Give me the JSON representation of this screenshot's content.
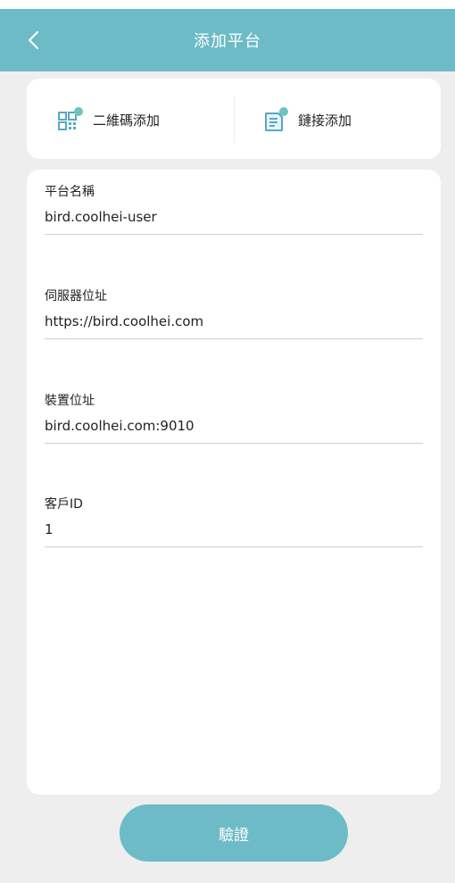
{
  "header": {
    "title": "添加平台",
    "back_icon": "chevron-left-icon",
    "color": "#6dbbc7"
  },
  "add_options": [
    {
      "label": "二維碼添加",
      "icon": "qr-code-icon"
    },
    {
      "label": "鏈接添加",
      "icon": "link-document-icon"
    }
  ],
  "form": {
    "fields": [
      {
        "label": "平台名稱",
        "value": "bird.coolhei-user"
      },
      {
        "label": "伺服器位址",
        "value": "https://bird.coolhei.com"
      },
      {
        "label": "裝置位址",
        "value": "bird.coolhei.com:9010"
      },
      {
        "label": "客戶ID",
        "value": "1"
      }
    ]
  },
  "verify_button": {
    "label": "驗證"
  }
}
